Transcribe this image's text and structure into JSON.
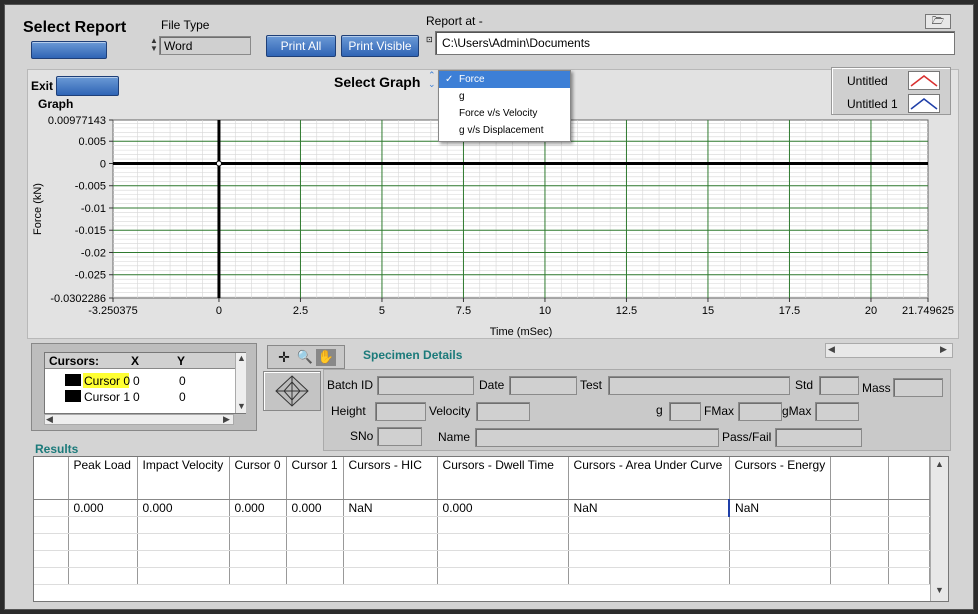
{
  "header": {
    "title": "Select Report",
    "file_type_label": "File Type",
    "file_type_value": "Word",
    "print_all_label": "Print All",
    "print_visible_label": "Print Visible",
    "report_at_label": "Report at -",
    "report_path": "C:\\Users\\Admin\\Documents"
  },
  "graph_section": {
    "exit_label": "Exit",
    "graph_label": "Graph",
    "select_graph_label": "Select Graph",
    "dropdown_options": [
      "Force",
      "g",
      "Force v/s Velocity",
      "g v/s Displacement"
    ],
    "selected_option": "Force",
    "check_mark": "✓",
    "legend": [
      {
        "name": "Untitled",
        "color": "#d93030"
      },
      {
        "name": "Untitled 1",
        "color": "#1f3fa8"
      }
    ]
  },
  "chart_data": {
    "type": "line",
    "xlabel": "Time (mSec)",
    "ylabel": "Force (kN)",
    "xlim": [
      -3.250375,
      21.749625
    ],
    "ylim": [
      -0.0302286,
      0.00977143
    ],
    "x_ticks": [
      "-3.250375",
      "0",
      "2.5",
      "5",
      "7.5",
      "10",
      "12.5",
      "15",
      "17.5",
      "20",
      "21.749625"
    ],
    "x_tick_values": [
      -3.250375,
      0,
      2.5,
      5,
      7.5,
      10,
      12.5,
      15,
      17.5,
      20,
      21.749625
    ],
    "y_ticks": [
      "0.00977143",
      "0.005",
      "0",
      "-0.005",
      "-0.01",
      "-0.015",
      "-0.02",
      "-0.025",
      "-0.0302286"
    ],
    "y_tick_values": [
      0.00977143,
      0.005,
      0,
      -0.005,
      -0.01,
      -0.015,
      -0.02,
      -0.025,
      -0.0302286
    ],
    "grid": true,
    "series": [
      {
        "name": "Untitled",
        "x": [],
        "y": []
      },
      {
        "name": "Untitled 1",
        "x": [],
        "y": []
      }
    ],
    "cursor_x": 0,
    "cursor_y": 0
  },
  "cursors": {
    "headers": [
      "Cursors:",
      "X",
      "Y"
    ],
    "rows": [
      {
        "name": "Cursor 0",
        "x": "0",
        "y": "0"
      },
      {
        "name": "Cursor 1",
        "x": "0",
        "y": "0"
      }
    ]
  },
  "specimen": {
    "title": "Specimen Details",
    "labels": {
      "batch_id": "Batch ID",
      "date": "Date",
      "test": "Test",
      "std": "Std",
      "mass": "Mass",
      "height": "Height",
      "velocity": "Velocity",
      "g": "g",
      "fmax": "FMax",
      "gmax": "gMax",
      "sno": "SNo",
      "name": "Name",
      "pass_fail": "Pass/Fail"
    }
  },
  "results": {
    "title": "Results",
    "columns": [
      "",
      "Peak Load",
      "Impact Velocity",
      "Cursor 0",
      "Cursor 1",
      "Cursors - HIC",
      "Cursors - Dwell Time",
      "Cursors - Area Under Curve",
      "Cursors - Energy",
      "",
      ""
    ],
    "rows": [
      [
        "",
        "0.000",
        "0.000",
        "0.000",
        "0.000",
        "NaN",
        "0.000",
        "NaN",
        "NaN",
        "",
        ""
      ]
    ]
  }
}
